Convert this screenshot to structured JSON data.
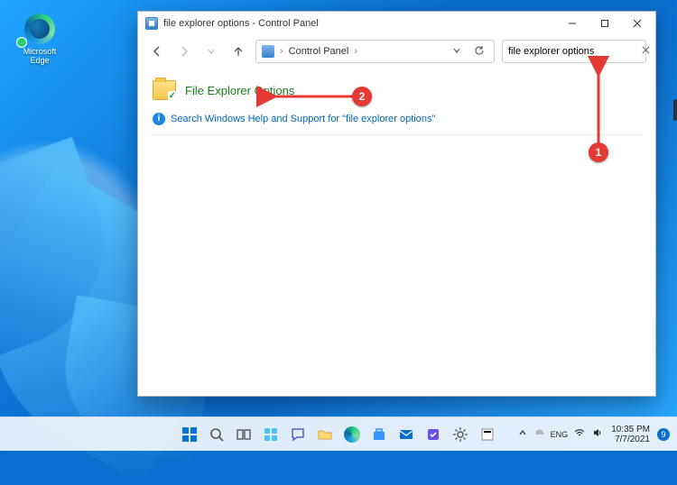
{
  "desktop": {
    "edge_label": "Microsoft\nEdge"
  },
  "window": {
    "title": "file explorer options - Control Panel",
    "breadcrumb": {
      "root": "Control Panel"
    },
    "search": {
      "value": "file explorer options"
    },
    "result": {
      "label": "File Explorer Options"
    },
    "help": {
      "text": "Search Windows Help and Support for \"file explorer options\""
    }
  },
  "annotations": {
    "one": "1",
    "two": "2"
  },
  "taskbar": {
    "time": "10:35 PM",
    "date": "7/7/2021",
    "notif_count": "9"
  }
}
